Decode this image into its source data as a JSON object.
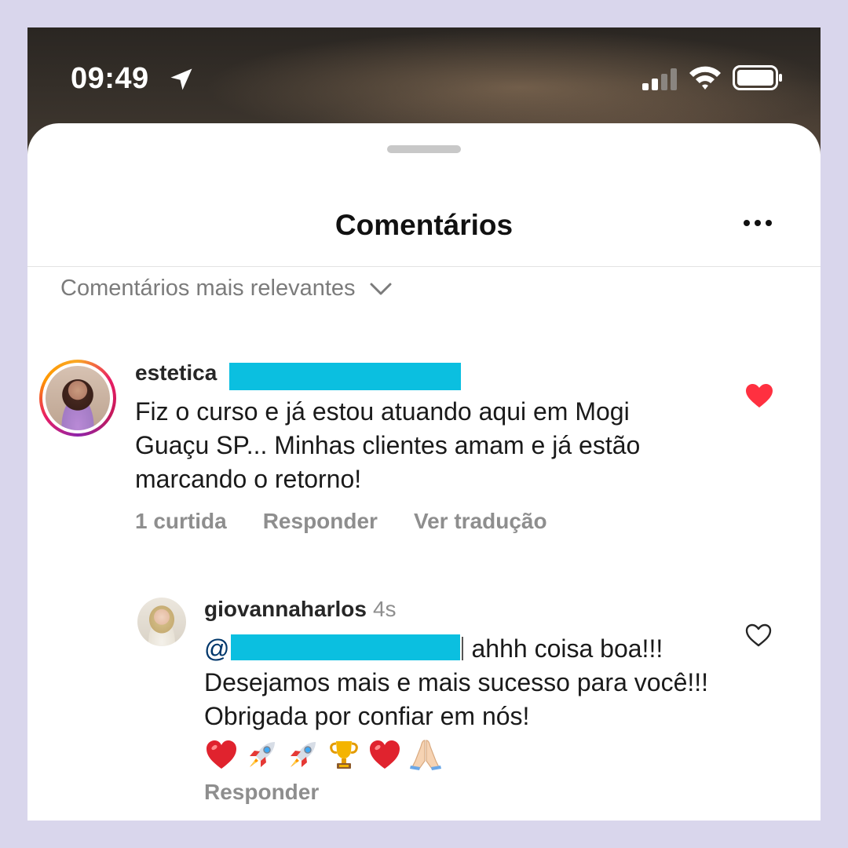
{
  "status_bar": {
    "time": "09:49",
    "icons": [
      "location-arrow-icon",
      "cellular-signal-icon",
      "wifi-icon",
      "battery-icon"
    ]
  },
  "sheet": {
    "title": "Comentários",
    "more_icon": "more-horizontal-icon",
    "sort_label": "Comentários mais relevantes",
    "sort_icon": "chevron-down-icon"
  },
  "comment": {
    "username": "estetica",
    "text": "Fiz o curso e já estou atuando aqui em Mogi Guaçu SP... Minhas clientes amam e já estão marcando o retorno!",
    "likes_label": "1 curtida",
    "reply_label": "Responder",
    "translate_label": "Ver tradução",
    "liked": true
  },
  "reply": {
    "username": "giovannaharlos",
    "time": "4s",
    "mention_prefix": "@",
    "text": "ahhh coisa boa!!! Desejamos mais e mais sucesso para você!!! Obrigada por confiar em nós!",
    "emojis": [
      "heart-emoji",
      "rocket-emoji",
      "rocket-emoji",
      "trophy-emoji",
      "heart-emoji",
      "folded-hands-emoji"
    ],
    "reply_label": "Responder",
    "liked": false
  },
  "colors": {
    "background": "#d9d6ec",
    "redaction": "#0bbfe0",
    "like_red": "#ff3040",
    "secondary_text": "#8e8e8e",
    "mention_blue": "#00376b"
  }
}
